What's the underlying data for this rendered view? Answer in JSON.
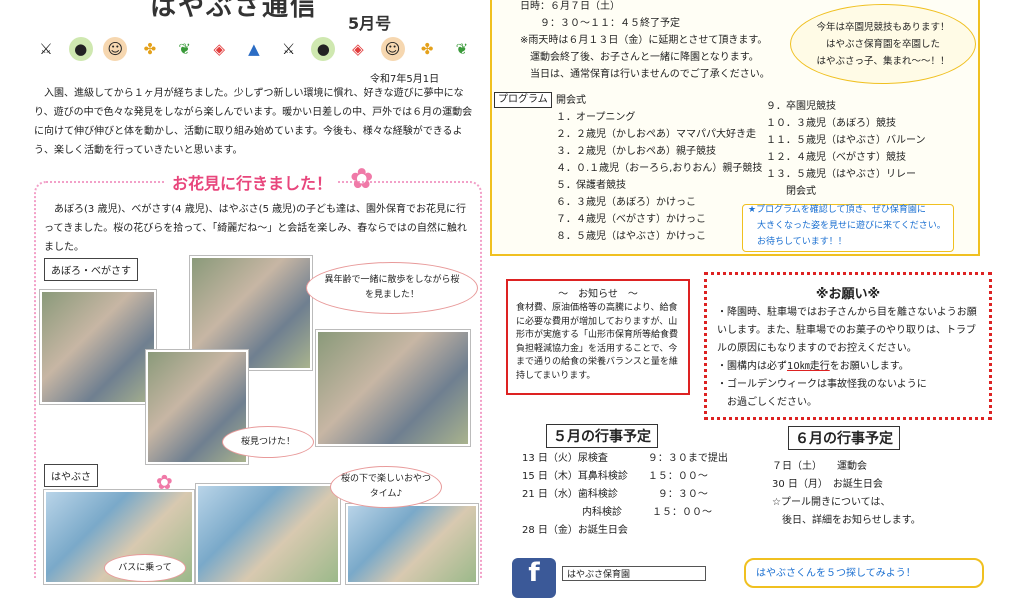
{
  "header": {
    "title": "はやぶさ通信",
    "issue": "5月号",
    "date": "令和7年5月1日"
  },
  "decorations": [
    "kabuto-icon",
    "kashiwamochi-icon",
    "child-face-icon",
    "pinwheel-icon",
    "leaf-icon",
    "koinobori-icon",
    "kabuto-paper-icon",
    "kabuto-icon",
    "kashiwamochi-icon",
    "koinobori-icon",
    "child-face-icon",
    "pinwheel-icon",
    "leaf-icon"
  ],
  "intro": "入園、進級してから１ヶ月が経ちました。少しずつ新しい環境に慣れ、好きな遊びに夢中になり、遊びの中で色々な発見をしながら楽しんでいます。暖かい日差しの中、戸外では６月の運動会に向けて伸び伸びと体を動かし、活動に取り組み始めています。今後も、様々な経験ができるよう、楽しく活動を行っていきたいと思います。",
  "hanami": {
    "title": "お花見に行きました！",
    "text": "あぼろ(3 歳児)、べがさす(4 歳児)、はやぶさ(5 歳児)の子ども達は、園外保育でお花見に行ってきました。桜の花びらを拾って、「綺麗だね～」と会話を楽しみ、春ならではの自然に触れました。",
    "label1": "あぼろ・べがさす",
    "label2": "はやぶさ",
    "bubble1": "異年齢で一緒に散歩をしながら桜を見ました！",
    "bubble2": "桜見つけた！",
    "bubble3": "桜の下で楽しいおやつタイム♪",
    "bubble4": "バスに乗って"
  },
  "event": {
    "lines": [
      "日時：６月７日（土）",
      "　　９：３０～１１：４５終了予定",
      "※雨天時は６月１３日（金）に延期とさせて頂きます。",
      "　運動会終了後、お子さんと一緒に降園となります。",
      "　当日は、通常保育は行いませんのでご了承ください。"
    ],
    "program_label": "プログラム",
    "program_left": [
      "開会式",
      "１．オープニング",
      "２．２歳児（かしおぺあ）ママパパ大好き走",
      "３．２歳児（かしおぺあ）親子競技",
      "４．０.１歳児（おーろら,おりおん）親子競技",
      "５．保護者競技",
      "６．３歳児（あぼろ）かけっこ",
      "７．４歳児（べがさす）かけっこ",
      "８．５歳児（はやぶさ）かけっこ"
    ],
    "program_right": [
      "９．卒園児競技",
      "１０．３歳児（あぼろ）競技",
      "１１．５歳児（はやぶさ）バルーン",
      "１２．４歳児（べがさす）競技",
      "１３．５歳児（はやぶさ）リレー",
      "　　閉会式"
    ],
    "cloud": [
      "今年は卒園児競技もあります！",
      "はやぶさ保育園を卒園した",
      "はやぶさっ子、集まれ～～！！"
    ],
    "note": [
      "★プログラムを確認して頂き、ぜひ保育園に",
      "　大きくなった姿を見せに遊びに来てください。",
      "　お待ちしています！！"
    ]
  },
  "oshirase": {
    "title": "～　お知らせ　～",
    "body": "食材費、原油価格等の高騰により、給食に必要な費用が増加しておりますが、山形市が実施する「山形市保育所等給食費負担軽減協力金」を活用することで、今まで通りの給食の栄養バランスと量を維持してまいります。"
  },
  "onegai": {
    "title": "※お願い※",
    "items": [
      "・降園時、駐車場ではお子さんから目を離さないようお願いします。また、駐車場でのお菓子のやり取りは、トラブルの原因にもなりますのでお控えください。",
      "・園構内は必ず",
      "10㎞走行",
      "をお願いします。",
      "・ゴールデンウィークは事故怪我のないように",
      "　お過ごしください。"
    ]
  },
  "may": {
    "title": "５月の行事予定",
    "lines": [
      "13 日（火）尿検査　　　　９：３０まで提出",
      "15 日（木）耳鼻科検診　　１５：００～",
      "21 日（水）歯科検診　　　　９：３０～",
      "　　　　　　内科検診　　　１５：００～",
      "28 日（金）お誕生日会"
    ]
  },
  "june": {
    "title": "６月の行事予定",
    "lines": [
      "７日（土）　　運動会",
      "30 日（月）　お誕生日会",
      "☆プール開きについては、",
      "　後日、詳細をお知らせします。"
    ]
  },
  "footer": {
    "fb_name": "はやぶさ保育園",
    "bottom_note": "はやぶさくんを５つ探してみよう！"
  }
}
